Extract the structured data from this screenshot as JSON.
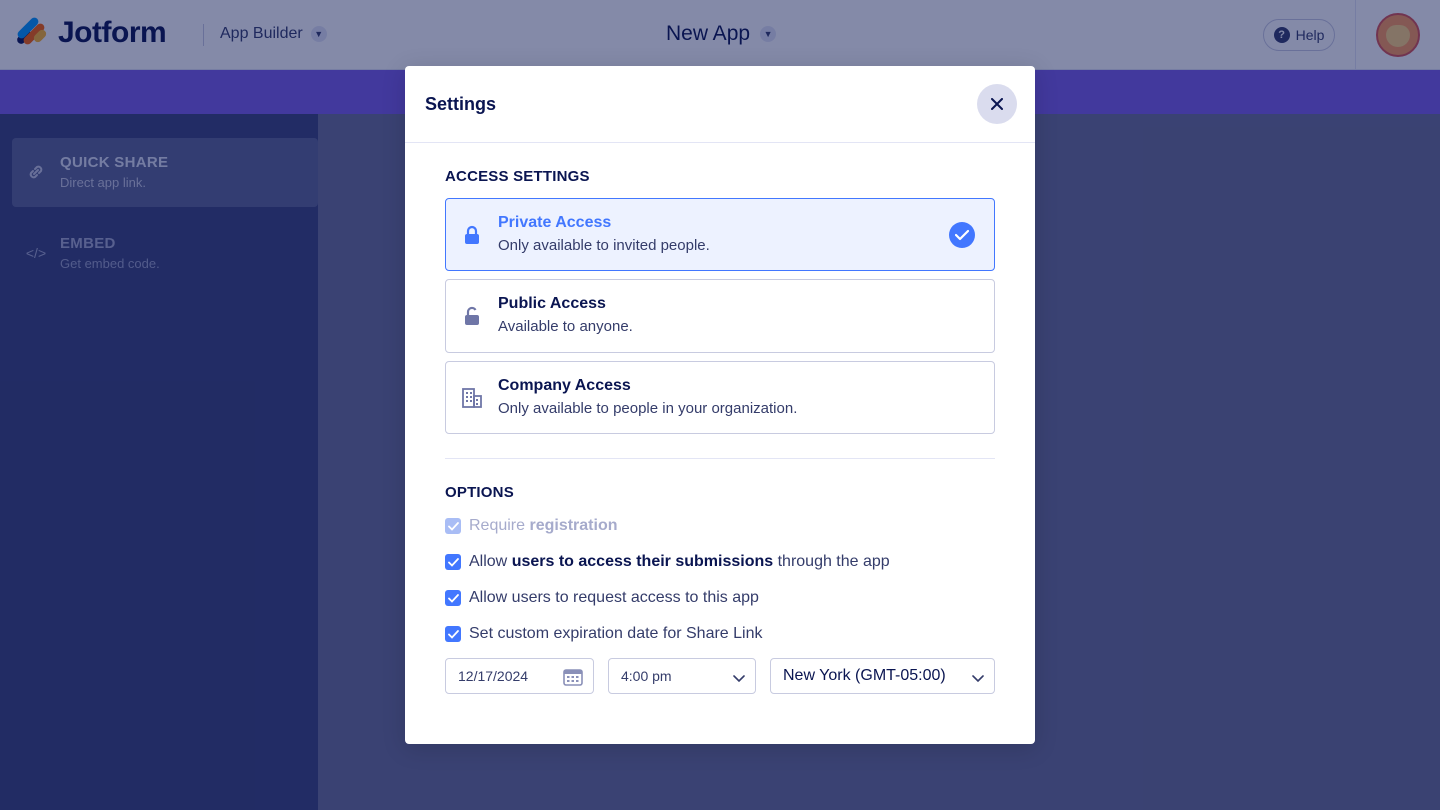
{
  "header": {
    "brand": "Jotform",
    "section": "App Builder",
    "app_name": "New App",
    "help_label": "Help"
  },
  "sidebar": {
    "items": [
      {
        "title": "QUICK SHARE",
        "subtitle": "Direct app link."
      },
      {
        "title": "EMBED",
        "subtitle": "Get embed code."
      }
    ]
  },
  "modal": {
    "title": "Settings",
    "access_section": "ACCESS SETTINGS",
    "access_options": [
      {
        "title": "Private Access",
        "subtitle": "Only available to invited people.",
        "selected": true
      },
      {
        "title": "Public Access",
        "subtitle": "Available to anyone.",
        "selected": false
      },
      {
        "title": "Company Access",
        "subtitle": "Only available to people in your organization.",
        "selected": false
      }
    ],
    "options_section": "OPTIONS",
    "options": {
      "require_registration": {
        "prefix": "Require",
        "bold": "registration",
        "checked": true,
        "disabled": true
      },
      "allow_submissions": {
        "prefix": "Allow",
        "bold": "users to access their submissions",
        "suffix": "through the app",
        "checked": true
      },
      "allow_request": {
        "label": "Allow users to request access to this app",
        "checked": true
      },
      "custom_expiration": {
        "label": "Set custom expiration date for Share Link",
        "checked": true
      }
    },
    "expiration": {
      "date": "12/17/2024",
      "time": "4:00 pm",
      "timezone": "New York (GMT-05:00)"
    }
  },
  "colors": {
    "primary": "#4277ff",
    "navy": "#0a1551",
    "sidebar": "#3b4378",
    "purple_bar": "#7b5ce8"
  }
}
